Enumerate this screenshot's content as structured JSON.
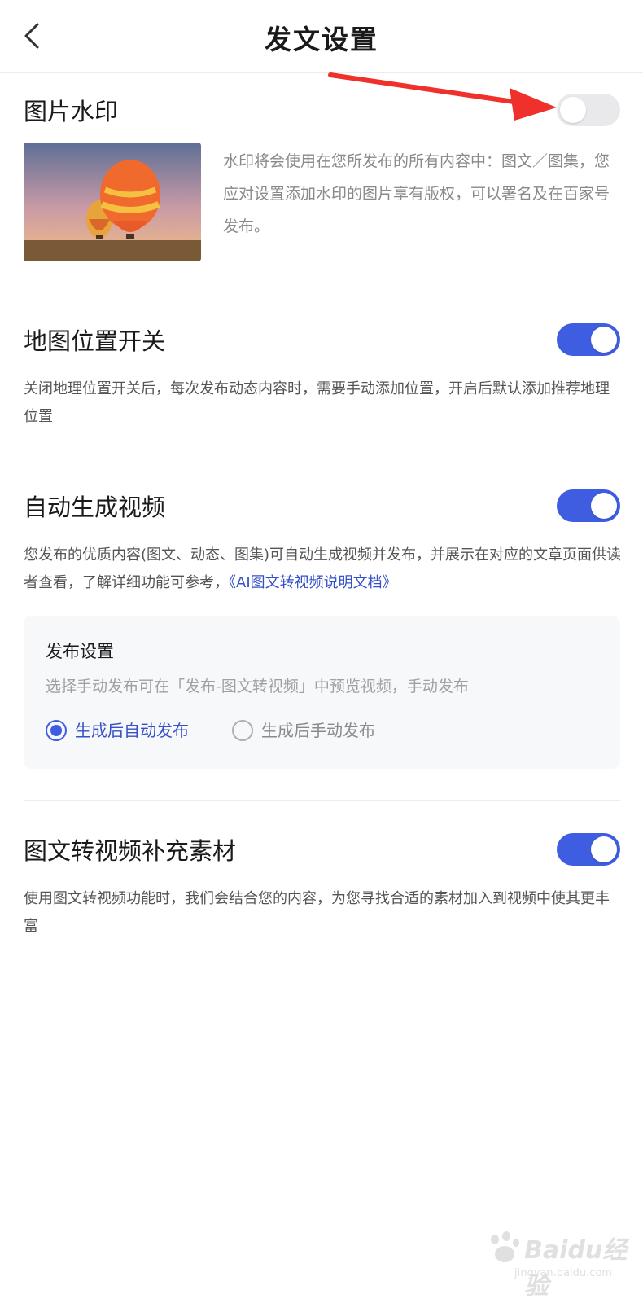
{
  "header": {
    "title": "发文设置"
  },
  "watermark": {
    "title": "图片水印",
    "enabled": false,
    "description": "水印将会使用在您所发布的所有内容中：图文／图集，您应对设置添加水印的图片享有版权，可以署名及在百家号发布。"
  },
  "location": {
    "title": "地图位置开关",
    "enabled": true,
    "description": "关闭地理位置开关后，每次发布动态内容时，需要手动添加位置，开启后默认添加推荐地理位置"
  },
  "auto_video": {
    "title": "自动生成视频",
    "enabled": true,
    "description": "您发布的优质内容(图文、动态、图集)可自动生成视频并发布，并展示在对应的文章页面供读者查看，了解详细功能可参考，",
    "link": "《AI图文转视频说明文档》",
    "publish_settings": {
      "title": "发布设置",
      "hint": "选择手动发布可在「发布-图文转视频」中预览视频，手动发布",
      "options": [
        "生成后自动发布",
        "生成后手动发布"
      ],
      "selected": "生成后自动发布"
    }
  },
  "supplement": {
    "title": "图文转视频补充素材",
    "enabled": true,
    "description": "使用图文转视频功能时，我们会结合您的内容，为您寻找合适的素材加入到视频中使其更丰富"
  },
  "colors": {
    "accent": "#3f5de0",
    "link": "#3550c8",
    "arrow": "#f0302a"
  },
  "watermark_overlay": {
    "brand": "Baidu经验",
    "url": "jingyan.baidu.com"
  }
}
